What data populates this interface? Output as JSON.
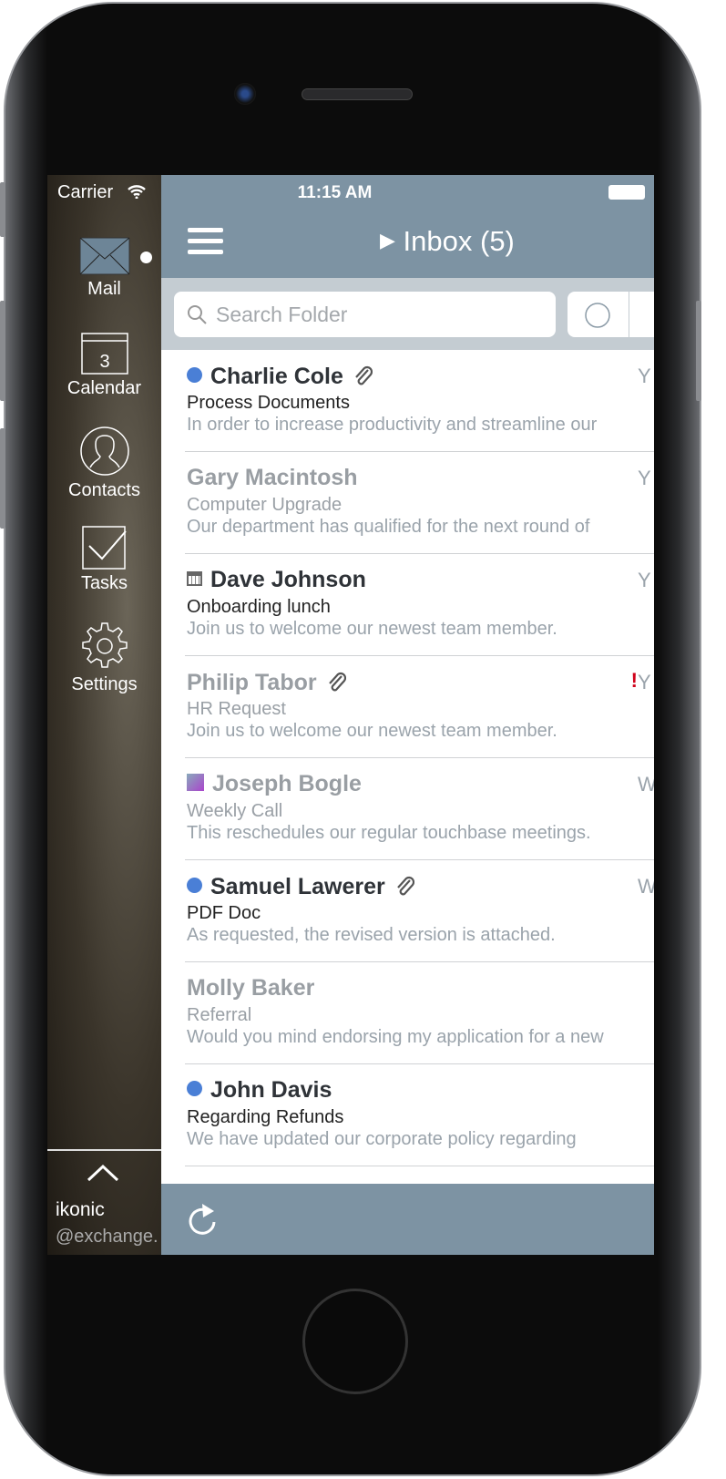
{
  "status": {
    "carrier": "Carrier",
    "time": "11:15 AM"
  },
  "sidebar": {
    "items": [
      {
        "label": "Mail",
        "icon": "mail-icon"
      },
      {
        "label": "Calendar",
        "icon": "calendar-icon",
        "day": "3"
      },
      {
        "label": "Contacts",
        "icon": "contacts-icon"
      },
      {
        "label": "Tasks",
        "icon": "tasks-icon"
      },
      {
        "label": "Settings",
        "icon": "gear-icon"
      }
    ],
    "account": {
      "name": "ikonic",
      "domain": "@exchange."
    }
  },
  "header": {
    "title": "Inbox (5)"
  },
  "search": {
    "placeholder": "Search Folder"
  },
  "colors": {
    "bar": "#7d93a3",
    "unread": "#4a7fd6",
    "flag": "#d0021b"
  },
  "messages": [
    {
      "from": "Charlie Cole",
      "subject": "Process Documents",
      "preview": "In order to increase productivity and streamline our",
      "unread": true,
      "attachment": true,
      "date": "Y"
    },
    {
      "from": "Gary Macintosh",
      "subject": "Computer Upgrade",
      "preview": "Our department has qualified for the next round of",
      "unread": false,
      "date": "Y"
    },
    {
      "from": "Dave Johnson",
      "subject": "Onboarding lunch",
      "preview": "Join us to welcome our newest team member.",
      "unread": false,
      "bold": true,
      "calendar": true,
      "date": "Y"
    },
    {
      "from": "Philip Tabor",
      "subject": "HR Request",
      "preview": "Join us to welcome our newest team member.",
      "unread": false,
      "attachment": true,
      "important": "!",
      "date": "Y"
    },
    {
      "from": "Joseph Bogle",
      "subject": "Weekly Call",
      "preview": "This reschedules our regular touchbase meetings.",
      "unread": false,
      "meeting": true,
      "date": "We"
    },
    {
      "from": "Samuel Lawerer",
      "subject": "PDF Doc",
      "preview": "As requested, the revised version is attached.",
      "unread": true,
      "attachment": true,
      "date": "We"
    },
    {
      "from": "Molly Baker",
      "subject": "Referral",
      "preview": "Would you mind endorsing my application for a new",
      "unread": false
    },
    {
      "from": "John Davis",
      "subject": "Regarding Refunds",
      "preview": "We have updated our corporate policy regarding",
      "unread": true
    }
  ]
}
